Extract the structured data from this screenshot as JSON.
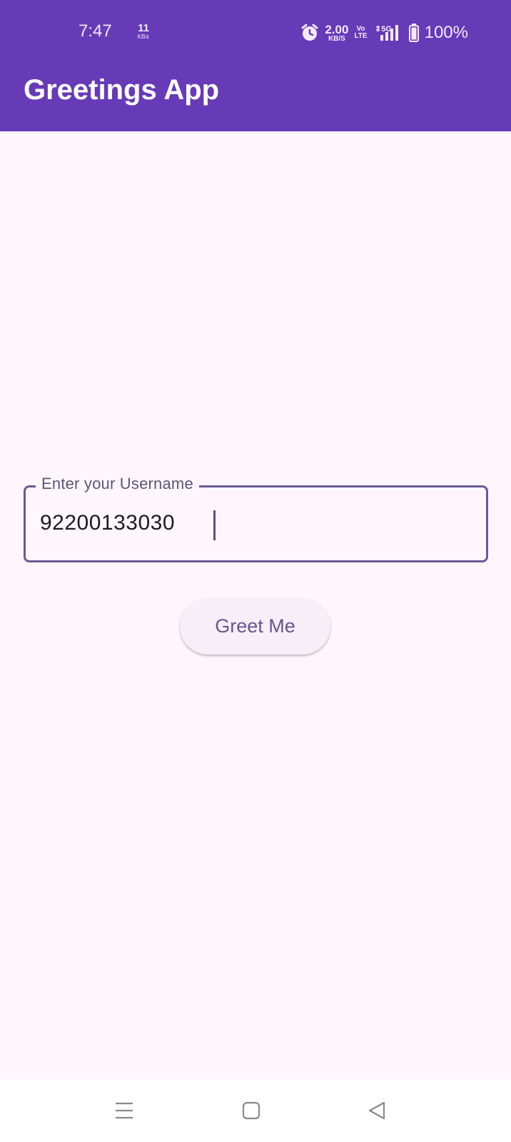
{
  "status_bar": {
    "time": "7:47",
    "data_speed": "11",
    "data_speed_unit": "KB/ε",
    "net_speed": "2.00",
    "net_speed_unit": "KB/S",
    "volte_top": "Vo",
    "volte_bottom": "LTE",
    "network": "5G",
    "battery": "100%",
    "icons": [
      "alarm-icon",
      "signal-icon",
      "battery-icon"
    ]
  },
  "app_bar": {
    "title": "Greetings App",
    "color": "#673ab7"
  },
  "form": {
    "username_label": "Enter your Username",
    "username_value": "92200133030",
    "greet_button": "Greet Me"
  },
  "nav_bar": {
    "icons": [
      "menu-icon",
      "home-icon",
      "back-icon"
    ]
  },
  "colors": {
    "primary": "#673ab7",
    "background": "#fdf7fd",
    "outline": "#6a5a94",
    "button_text": "#65558f"
  }
}
